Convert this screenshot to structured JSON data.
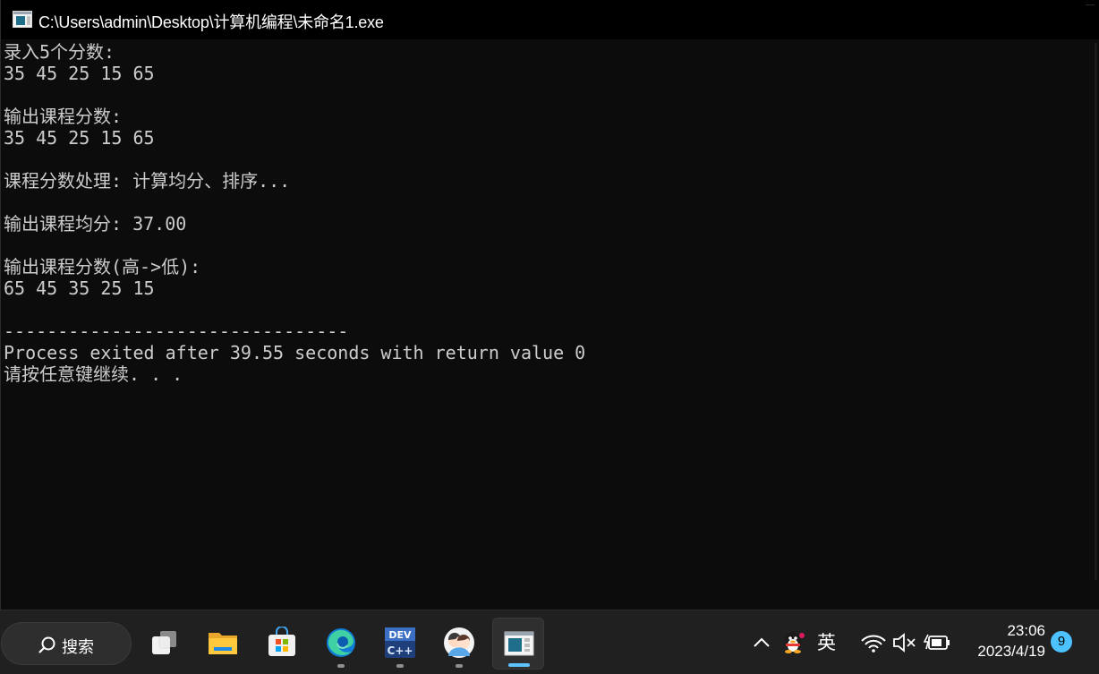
{
  "window": {
    "title": "C:\\Users\\admin\\Desktop\\计算机编程\\未命名1.exe",
    "icon": "console-app-icon"
  },
  "console": {
    "lines": [
      "录入5个分数:",
      "35 45 25 15 65",
      "",
      "输出课程分数:",
      "35 45 25 15 65",
      "",
      "课程分数处理: 计算均分、排序...",
      "",
      "输出课程均分: 37.00",
      "",
      "输出课程分数(高->低):",
      "65 45 35 25 15",
      "",
      "--------------------------------",
      "Process exited after 39.55 seconds with return value 0",
      "请按任意键继续. . ."
    ]
  },
  "taskbar": {
    "search_label": "搜索",
    "apps": [
      {
        "name": "task-view",
        "icon": "task-view-icon",
        "running": false
      },
      {
        "name": "file-explorer",
        "icon": "folder-icon",
        "running": false
      },
      {
        "name": "microsoft-store",
        "icon": "store-icon",
        "running": false
      },
      {
        "name": "edge",
        "icon": "edge-icon",
        "running": true
      },
      {
        "name": "dev-cpp",
        "icon": "devcpp-icon",
        "running": true
      },
      {
        "name": "qq-friends",
        "icon": "people-icon",
        "running": true
      },
      {
        "name": "console-window",
        "icon": "console-app-icon",
        "running": true,
        "active": true
      }
    ],
    "tray": {
      "ime_label": "英",
      "icons": [
        "chevron-up-icon",
        "qq-penguin-icon",
        "wifi-icon",
        "speaker-muted-icon",
        "battery-charging-icon"
      ]
    },
    "clock": {
      "time": "23:06",
      "date": "2023/4/19"
    },
    "notification_count": "9"
  },
  "colors": {
    "console_bg": "#0c0c0c",
    "console_fg": "#cccccc",
    "taskbar_bg": "#202020",
    "accent": "#4cc2ff"
  }
}
